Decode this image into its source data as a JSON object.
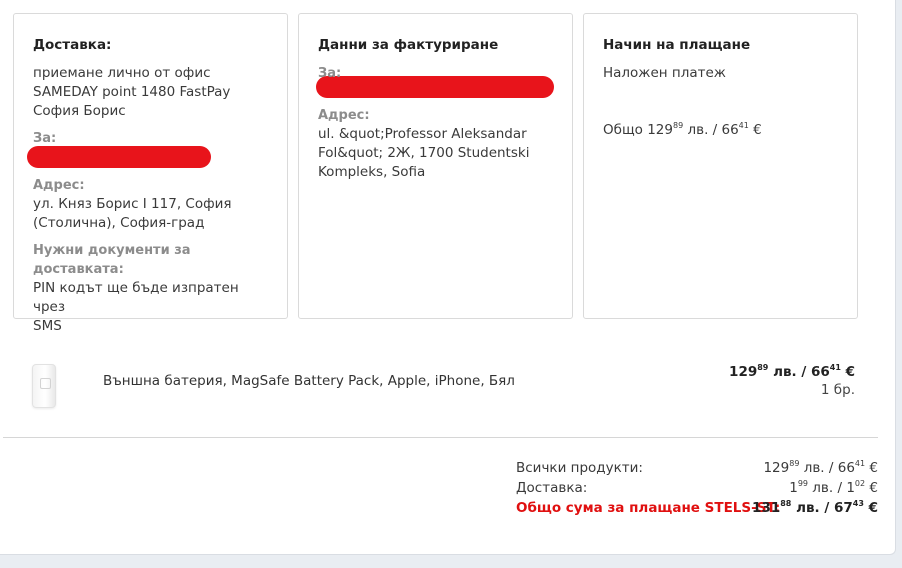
{
  "delivery": {
    "title": "Доставка:",
    "method_lines": [
      "приемане лично от офис",
      "SAMEDAY point 1480 FastPay",
      "София Борис"
    ],
    "for_label": "За:",
    "address_label": "Адрес:",
    "address_lines": [
      "ул. Княз Борис I 117, София",
      "(Столична), София-град"
    ],
    "docs_label": "Нужни документи за доставката:",
    "docs_lines": [
      "PIN кодът ще бъде изпратен чрез",
      "SMS"
    ]
  },
  "billing": {
    "title": "Данни за фактуриране",
    "for_label": "За:",
    "address_label": "Адрес:",
    "address_lines": [
      "ul. &quot;Professor Aleksandar",
      "Fol&quot; 2Ж, 1700 Studentski",
      "Kompleks, Sofia"
    ]
  },
  "payment": {
    "title": "Начин на плащане",
    "method": "Наложен платеж",
    "total_prefix": "Общо 129",
    "total_sup1": "89",
    "total_mid": " лв. / 66",
    "total_sup2": "41",
    "total_suffix": " €"
  },
  "product": {
    "name": "Външна батерия, MagSafe Battery Pack, Apple, iPhone, Бял",
    "price_bgn_int": "129",
    "price_bgn_dec": "89",
    "price_eur_int": "66",
    "price_eur_dec": "41",
    "qty": "1 бр."
  },
  "totals": {
    "products_label": "Всички продукти:",
    "products_bgn_int": "129",
    "products_bgn_dec": "89",
    "products_eur_int": "66",
    "products_eur_dec": "41",
    "delivery_label": "Доставка:",
    "delivery_bgn_int": "1",
    "delivery_bgn_dec": "99",
    "delivery_eur_int": "1",
    "delivery_eur_dec": "02",
    "grand_label": "Общо сума за плащане STELS-ST:",
    "grand_bgn_int": "131",
    "grand_bgn_dec": "88",
    "grand_eur_int": "67",
    "grand_eur_dec": "43"
  },
  "units": {
    "bgn": " лв. / ",
    "eur": " €"
  },
  "colors": {
    "accent_red": "#e01010",
    "redaction": "#e8141b"
  }
}
